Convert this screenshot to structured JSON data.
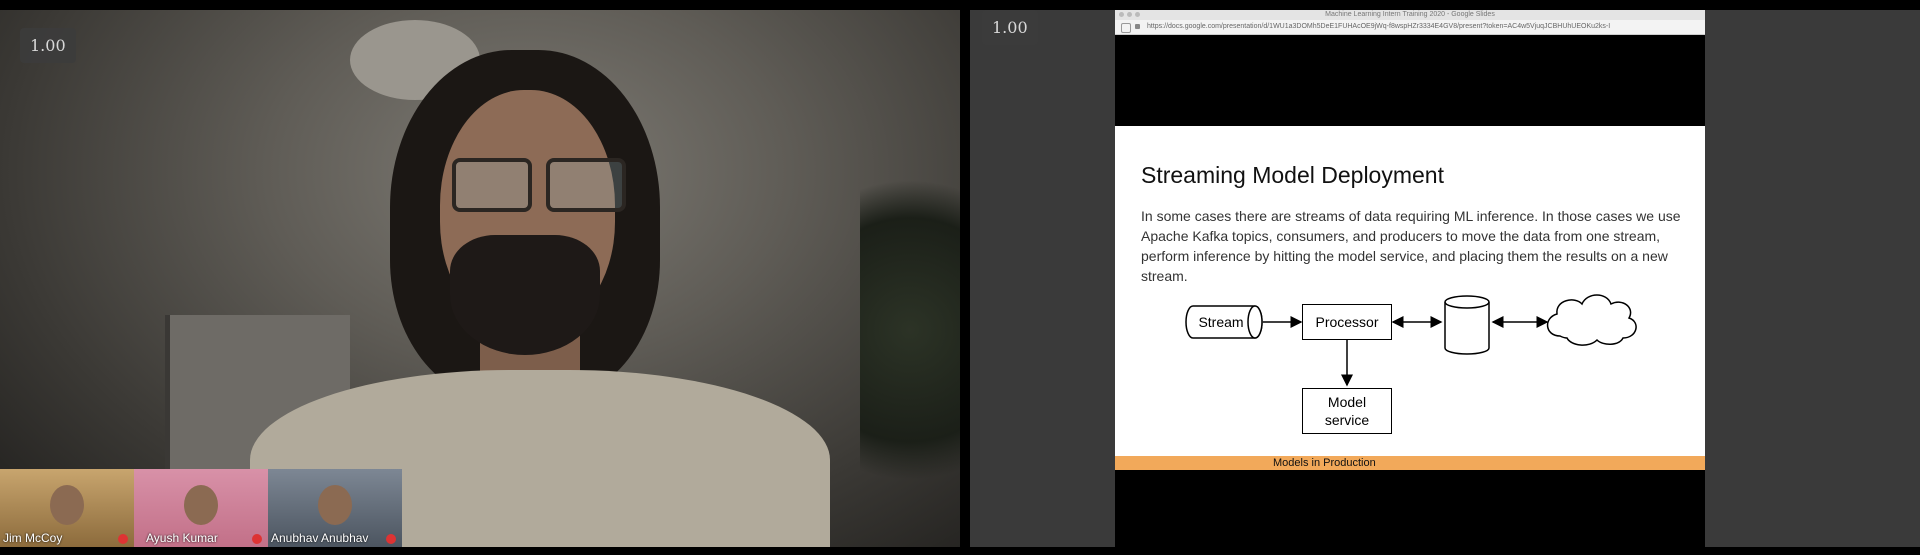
{
  "left_video": {
    "zoom_badge": "1.00",
    "participants": [
      {
        "name": "Jim McCoy"
      },
      {
        "name": "Ayush Kumar"
      },
      {
        "name": "Anubhav Anubhav"
      }
    ]
  },
  "right_share": {
    "zoom_badge": "1.00",
    "browser": {
      "window_title": "Machine Learning Intern Training 2020 - Google Slides",
      "url": "https://docs.google.com/presentation/d/1WU1a3DOMh5DeE1FUHAcOE9jWq-f8wspHZr3334E4GV8/present?token=AC4w5VjuqJCBHUhUEOKu2ks-I"
    },
    "slide": {
      "title": "Streaming Model Deployment",
      "body": "In some cases there are streams of data requiring ML inference. In those cases we use Apache Kafka topics, consumers, and producers to move the data from one stream, perform inference by hitting the model service, and placing them the results on a new stream.",
      "diagram": {
        "stream_label": "Stream",
        "processor_label": "Processor",
        "model_service_label": "Model service"
      },
      "footer": "Models in Production",
      "footer_color": "#f2a95a"
    }
  }
}
